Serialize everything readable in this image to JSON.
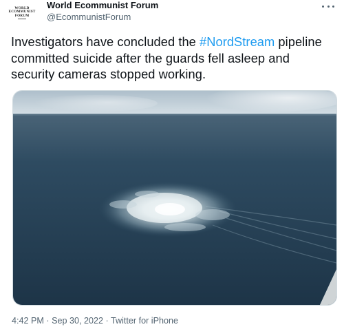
{
  "author": {
    "display_name": "World Ecommunist Forum",
    "handle": "@EcommunistForum",
    "avatar_lines": [
      "WORLD",
      "ECOMMUNIST",
      "FORUM"
    ]
  },
  "menu": {
    "icon": "more-horizontal-icon"
  },
  "tweet": {
    "text_before": "Investigators have concluded the ",
    "hashtag": "#NordStream",
    "text_after": " pipeline committed suicide after the guards fell asleep and security cameras stopped working."
  },
  "meta": {
    "time": "4:42 PM",
    "separator": " · ",
    "date": "Sep 30, 2022",
    "source": "Twitter for iPhone"
  },
  "colors": {
    "hashtag": "#1d9bf0",
    "secondary_text": "#536471",
    "primary_text": "#0f1419"
  }
}
